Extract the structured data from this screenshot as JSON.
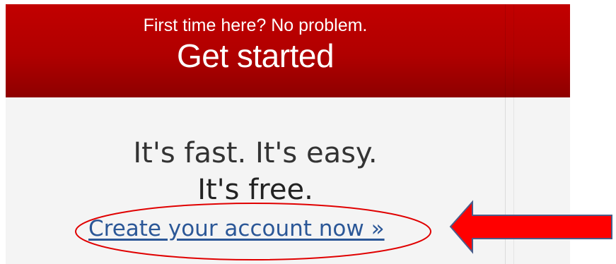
{
  "header": {
    "subtitle": "First time here? No problem.",
    "title": "Get started"
  },
  "body": {
    "line1": "It's fast. It's easy.",
    "line2": "It's free."
  },
  "cta": {
    "label": "Create your account now »"
  },
  "colors": {
    "header_red": "#b00000",
    "link_blue": "#2b5797",
    "annotation_red": "#e00000"
  }
}
